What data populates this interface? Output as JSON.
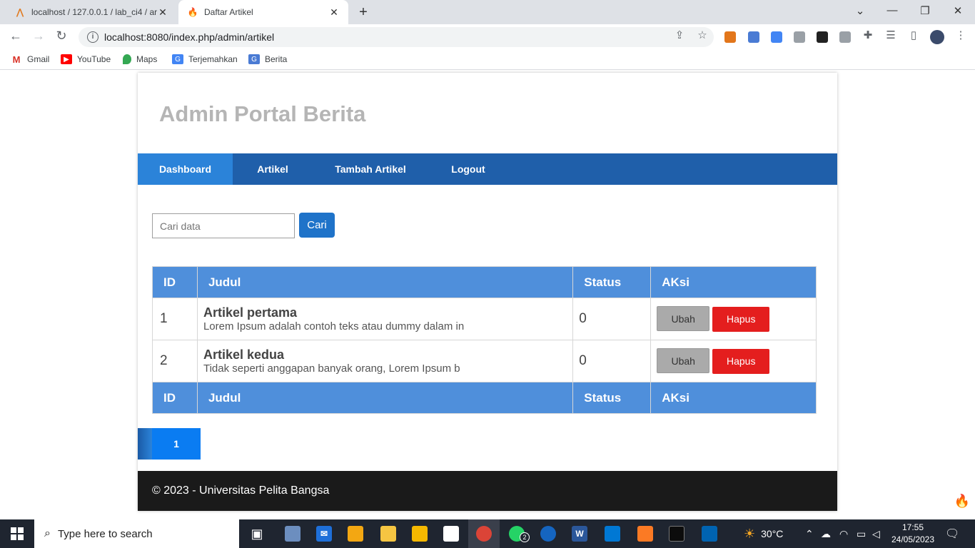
{
  "browser": {
    "tabs": [
      {
        "title": "localhost / 127.0.0.1 / lab_ci4 / ar",
        "favicon": "phpmyadmin-icon"
      },
      {
        "title": "Daftar Artikel",
        "favicon": "codeigniter-icon"
      }
    ],
    "url": "localhost:8080/index.php/admin/artikel",
    "bookmarks": [
      "Gmail",
      "YouTube",
      "Maps",
      "Terjemahkan",
      "Berita"
    ]
  },
  "page": {
    "site_title": "Admin Portal Berita",
    "nav": [
      "Dashboard",
      "Artikel",
      "Tambah Artikel",
      "Logout"
    ],
    "search": {
      "placeholder": "Cari data",
      "button": "Cari"
    },
    "table": {
      "headers": [
        "ID",
        "Judul",
        "Status",
        "AKsi"
      ],
      "rows": [
        {
          "id": "1",
          "title": "Artikel pertama",
          "desc": "Lorem Ipsum adalah contoh teks atau dummy dalam in",
          "status": "0",
          "edit": "Ubah",
          "delete": "Hapus"
        },
        {
          "id": "2",
          "title": "Artikel kedua",
          "desc": "Tidak seperti anggapan banyak orang, Lorem Ipsum b",
          "status": "0",
          "edit": "Ubah",
          "delete": "Hapus"
        }
      ]
    },
    "pagination": {
      "current": "1"
    },
    "footer": "© 2023 - Universitas Pelita Bangsa"
  },
  "taskbar": {
    "search_placeholder": "Type here to search",
    "whatsapp_badge": "2",
    "weather": "30°C",
    "time": "17:55",
    "date": "24/05/2023"
  }
}
